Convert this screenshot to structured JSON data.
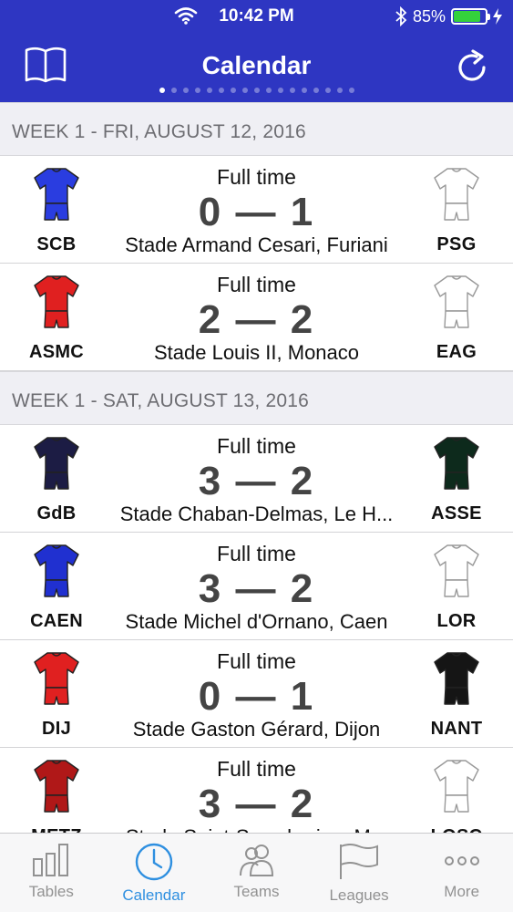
{
  "status_bar": {
    "time": "10:42 PM",
    "battery": "85%",
    "battery_level": 0.85
  },
  "nav": {
    "title": "Calendar",
    "page_count": 17,
    "active_page": 0
  },
  "colors": {
    "header": "#2e36c2",
    "accent": "#2e8fe0"
  },
  "sections": [
    {
      "title": "WEEK 1 - FRI, AUGUST 12, 2016",
      "matches": [
        {
          "home": "SCB",
          "away": "PSG",
          "status": "Full time",
          "score": "0 — 1",
          "venue": "Stade Armand Cesari, Furiani",
          "home_kit": "#2a3de0",
          "away_kit": "#ffffff"
        },
        {
          "home": "ASMC",
          "away": "EAG",
          "status": "Full time",
          "score": "2 — 2",
          "venue": "Stade Louis II, Monaco",
          "home_kit": "#e02020",
          "away_kit": "#ffffff"
        }
      ]
    },
    {
      "title": "WEEK 1 - SAT, AUGUST 13, 2016",
      "matches": [
        {
          "home": "GdB",
          "away": "ASSE",
          "status": "Full time",
          "score": "3 — 2",
          "venue": "Stade Chaban-Delmas, Le H...",
          "home_kit": "#1c1c44",
          "away_kit": "#0d2a1c"
        },
        {
          "home": "CAEN",
          "away": "LOR",
          "status": "Full time",
          "score": "3 — 2",
          "venue": "Stade Michel d'Ornano, Caen",
          "home_kit": "#2030d0",
          "away_kit": "#ffffff"
        },
        {
          "home": "DIJ",
          "away": "NANT",
          "status": "Full time",
          "score": "0 — 1",
          "venue": "Stade Gaston Gérard, Dijon",
          "home_kit": "#e02020",
          "away_kit": "#151515"
        },
        {
          "home": "METZ",
          "away": "LOSC",
          "status": "Full time",
          "score": "3 — 2",
          "venue": "Stade Saint-Symphorien, M...",
          "home_kit": "#b01818",
          "away_kit": "#ffffff"
        }
      ]
    }
  ],
  "tabs": [
    {
      "label": "Tables",
      "icon": "bar-chart-icon",
      "active": false
    },
    {
      "label": "Calendar",
      "icon": "clock-icon",
      "active": true
    },
    {
      "label": "Teams",
      "icon": "people-icon",
      "active": false
    },
    {
      "label": "Leagues",
      "icon": "flag-icon",
      "active": false
    },
    {
      "label": "More",
      "icon": "more-icon",
      "active": false
    }
  ]
}
